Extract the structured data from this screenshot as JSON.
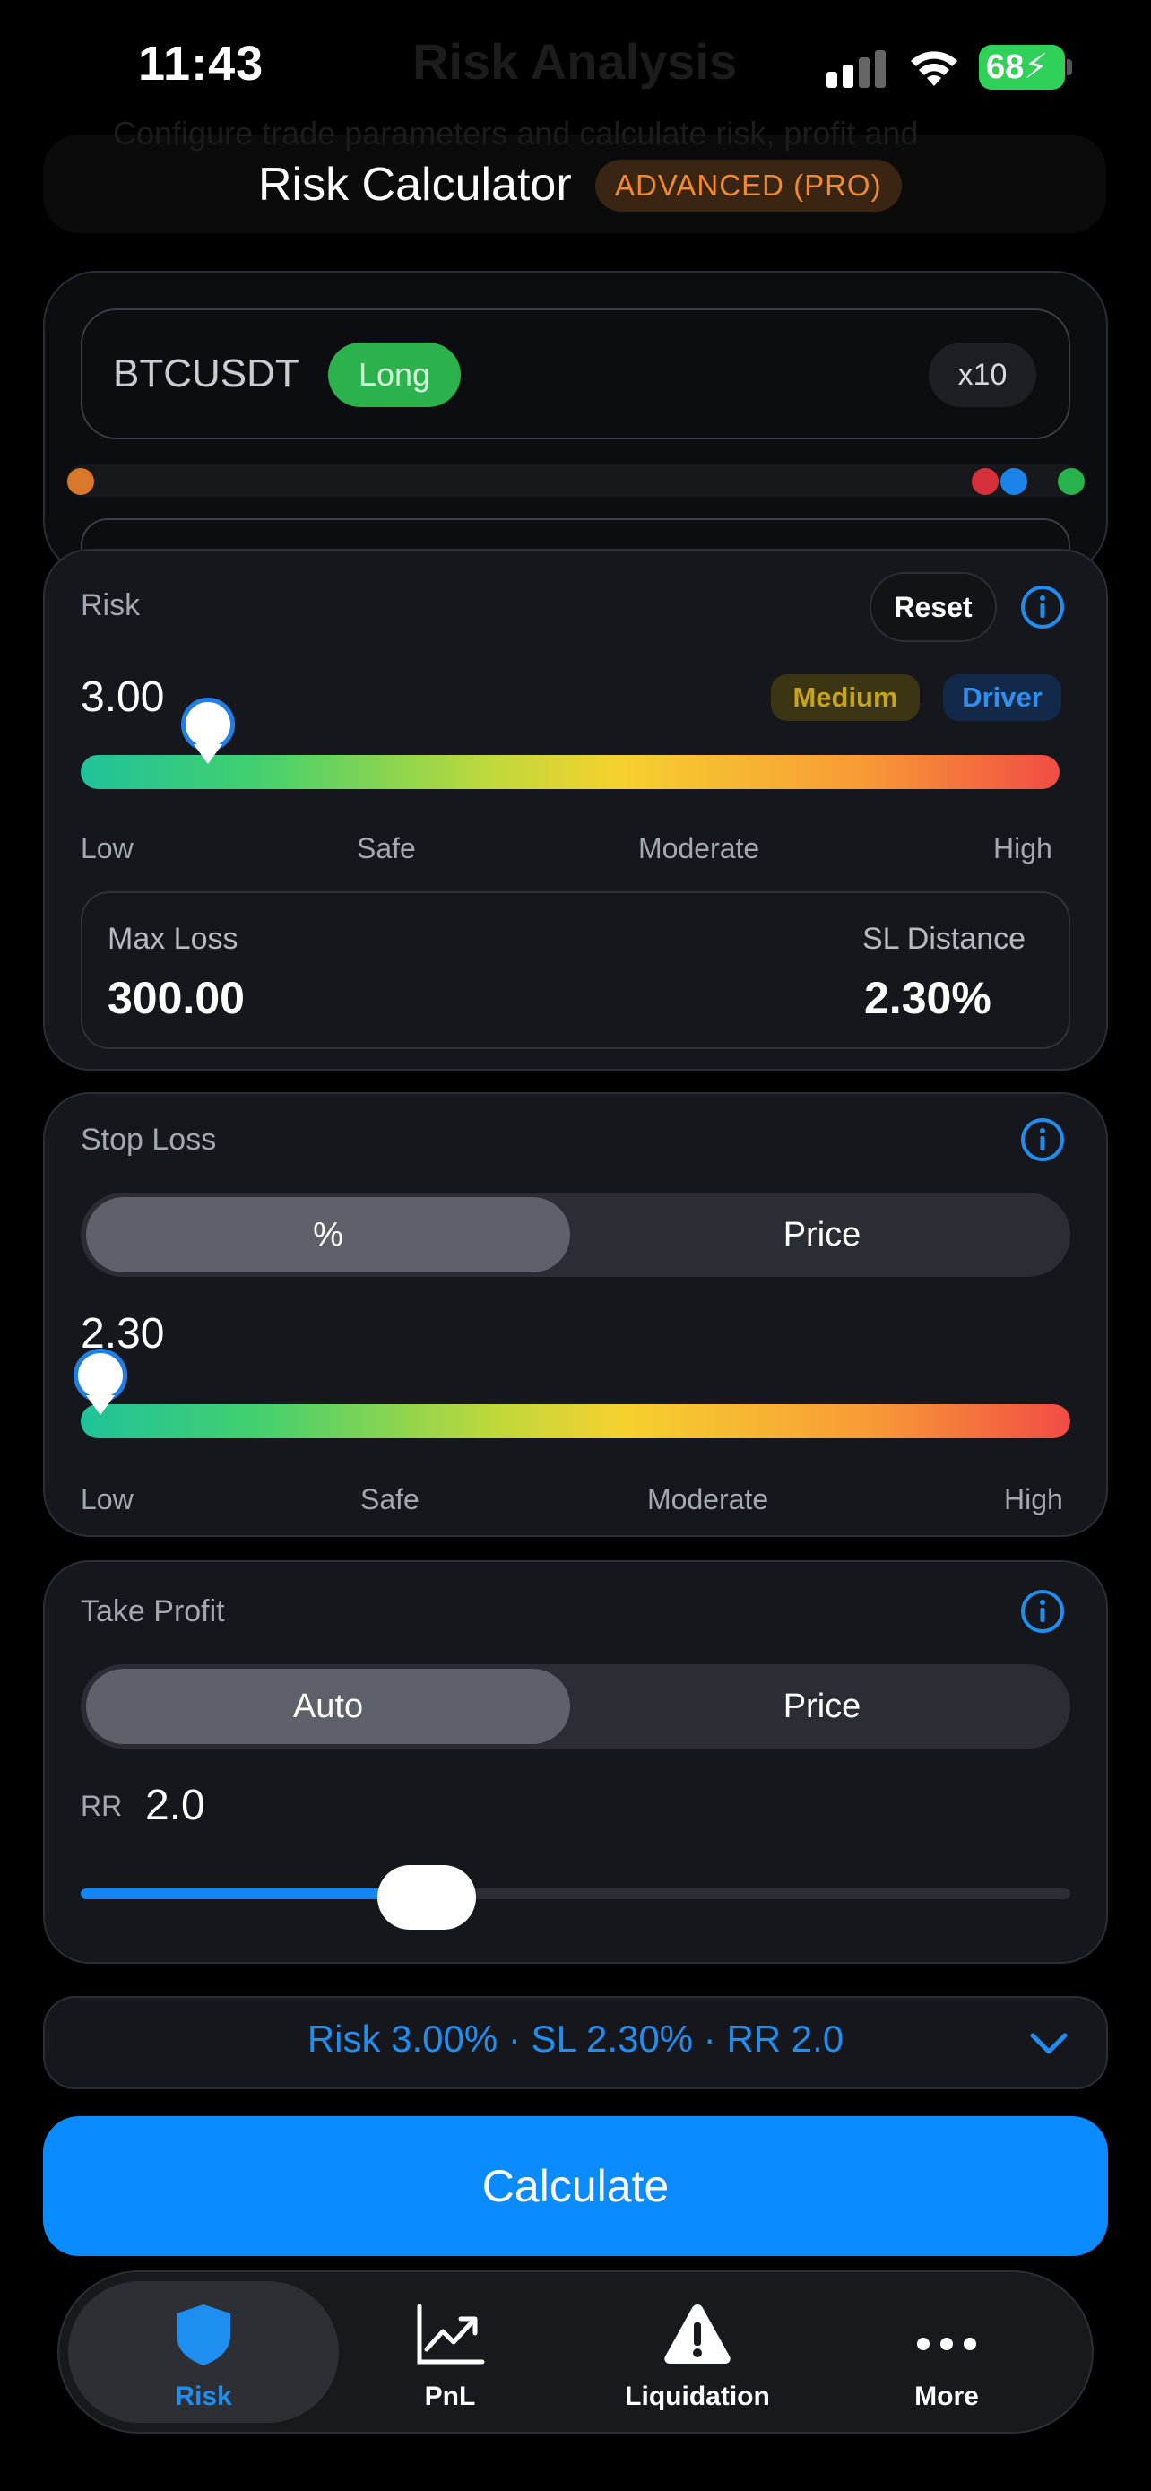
{
  "status": {
    "time": "11:43",
    "battery": "68"
  },
  "background": {
    "title": "Risk Analysis",
    "subtitle": "Configure trade parameters and calculate risk, profit and"
  },
  "header": {
    "title": "Risk Calculator",
    "badge": "ADVANCED (PRO)"
  },
  "position": {
    "symbol": "BTCUSDT",
    "side": "Long",
    "leverage": "x10"
  },
  "risk": {
    "label": "Risk",
    "reset_label": "Reset",
    "value": "3.00",
    "slider_fraction": 0.13,
    "level_badge": "Medium",
    "driver_badge": "Driver",
    "scale": [
      "Low",
      "Safe",
      "Moderate",
      "High"
    ],
    "max_loss_label": "Max Loss",
    "max_loss_value": "300.00",
    "sl_distance_label": "SL Distance",
    "sl_distance_value": "2.30%"
  },
  "stop_loss": {
    "label": "Stop Loss",
    "mode_options": [
      "%",
      "Price"
    ],
    "selected_mode": "%",
    "value": "2.30",
    "slider_fraction": 0.02,
    "scale": [
      "Low",
      "Safe",
      "Moderate",
      "High"
    ]
  },
  "take_profit": {
    "label": "Take Profit",
    "mode_options": [
      "Auto",
      "Price"
    ],
    "selected_mode": "Auto",
    "rr_label": "RR",
    "rr_value": "2.0",
    "slider_fraction": 0.35
  },
  "summary": {
    "text": "Risk 3.00% · SL 2.30% · RR 2.0"
  },
  "actions": {
    "calculate_label": "Calculate"
  },
  "tabs": [
    {
      "label": "Risk",
      "icon": "shield-icon",
      "active": true
    },
    {
      "label": "PnL",
      "icon": "chart-up-icon",
      "active": false
    },
    {
      "label": "Liquidation",
      "icon": "warning-icon",
      "active": false
    },
    {
      "label": "More",
      "icon": "more-icon",
      "active": false
    }
  ],
  "colors": {
    "accent": "#0a8bff",
    "long": "#2bb24c",
    "pro": "#f08a30",
    "medium": "#c7a519"
  }
}
